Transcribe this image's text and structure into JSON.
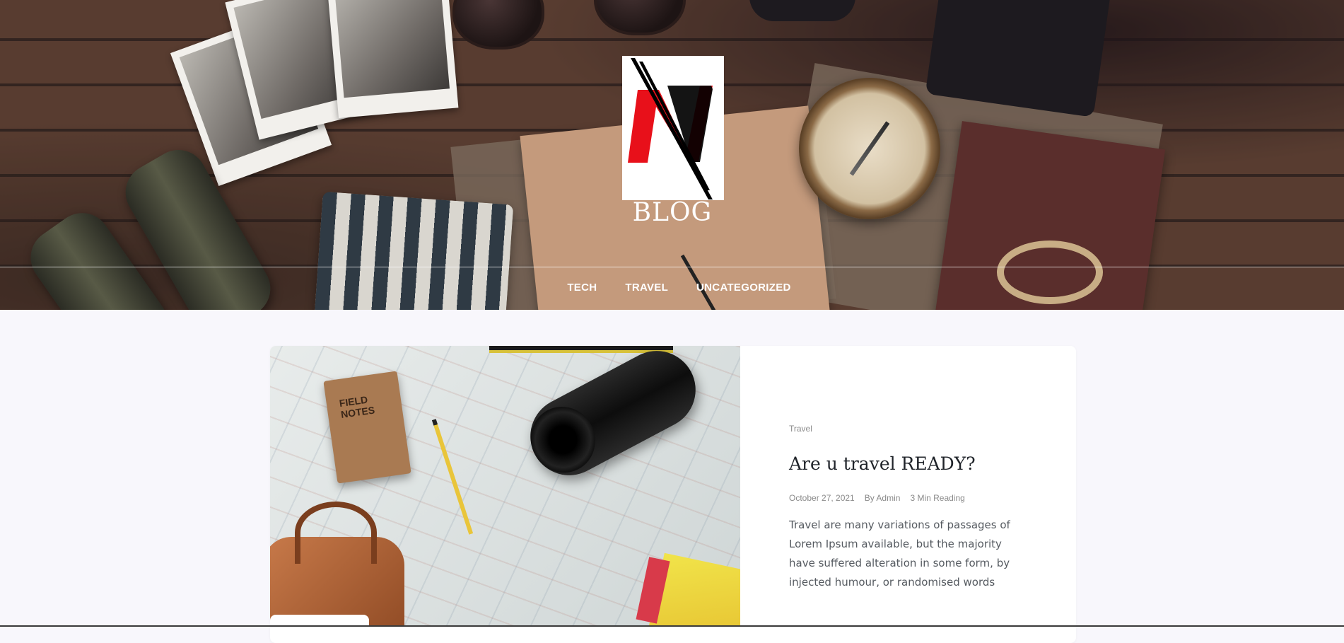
{
  "header": {
    "logo_letter": "N",
    "site_title": "BLOG"
  },
  "nav": {
    "items": [
      {
        "label": "TECH"
      },
      {
        "label": "TRAVEL"
      },
      {
        "label": "UNCATEGORIZED"
      }
    ]
  },
  "post": {
    "image_text": "FIELD NOTES",
    "category": "Travel",
    "title": "Are u travel READY?",
    "date": "October 27, 2021",
    "author": "By Admin",
    "reading_time": "3 Min Reading",
    "excerpt": "Travel are many variations of passages of Lorem Ipsum available, but the majority have suffered alteration in some form, by injected humour, or randomised words"
  },
  "colors": {
    "page_bg": "#f8f7fc",
    "logo_red": "#e8101a",
    "logo_black": "#000000",
    "title_text": "#1f2329",
    "meta_text": "#8a8a8a"
  }
}
